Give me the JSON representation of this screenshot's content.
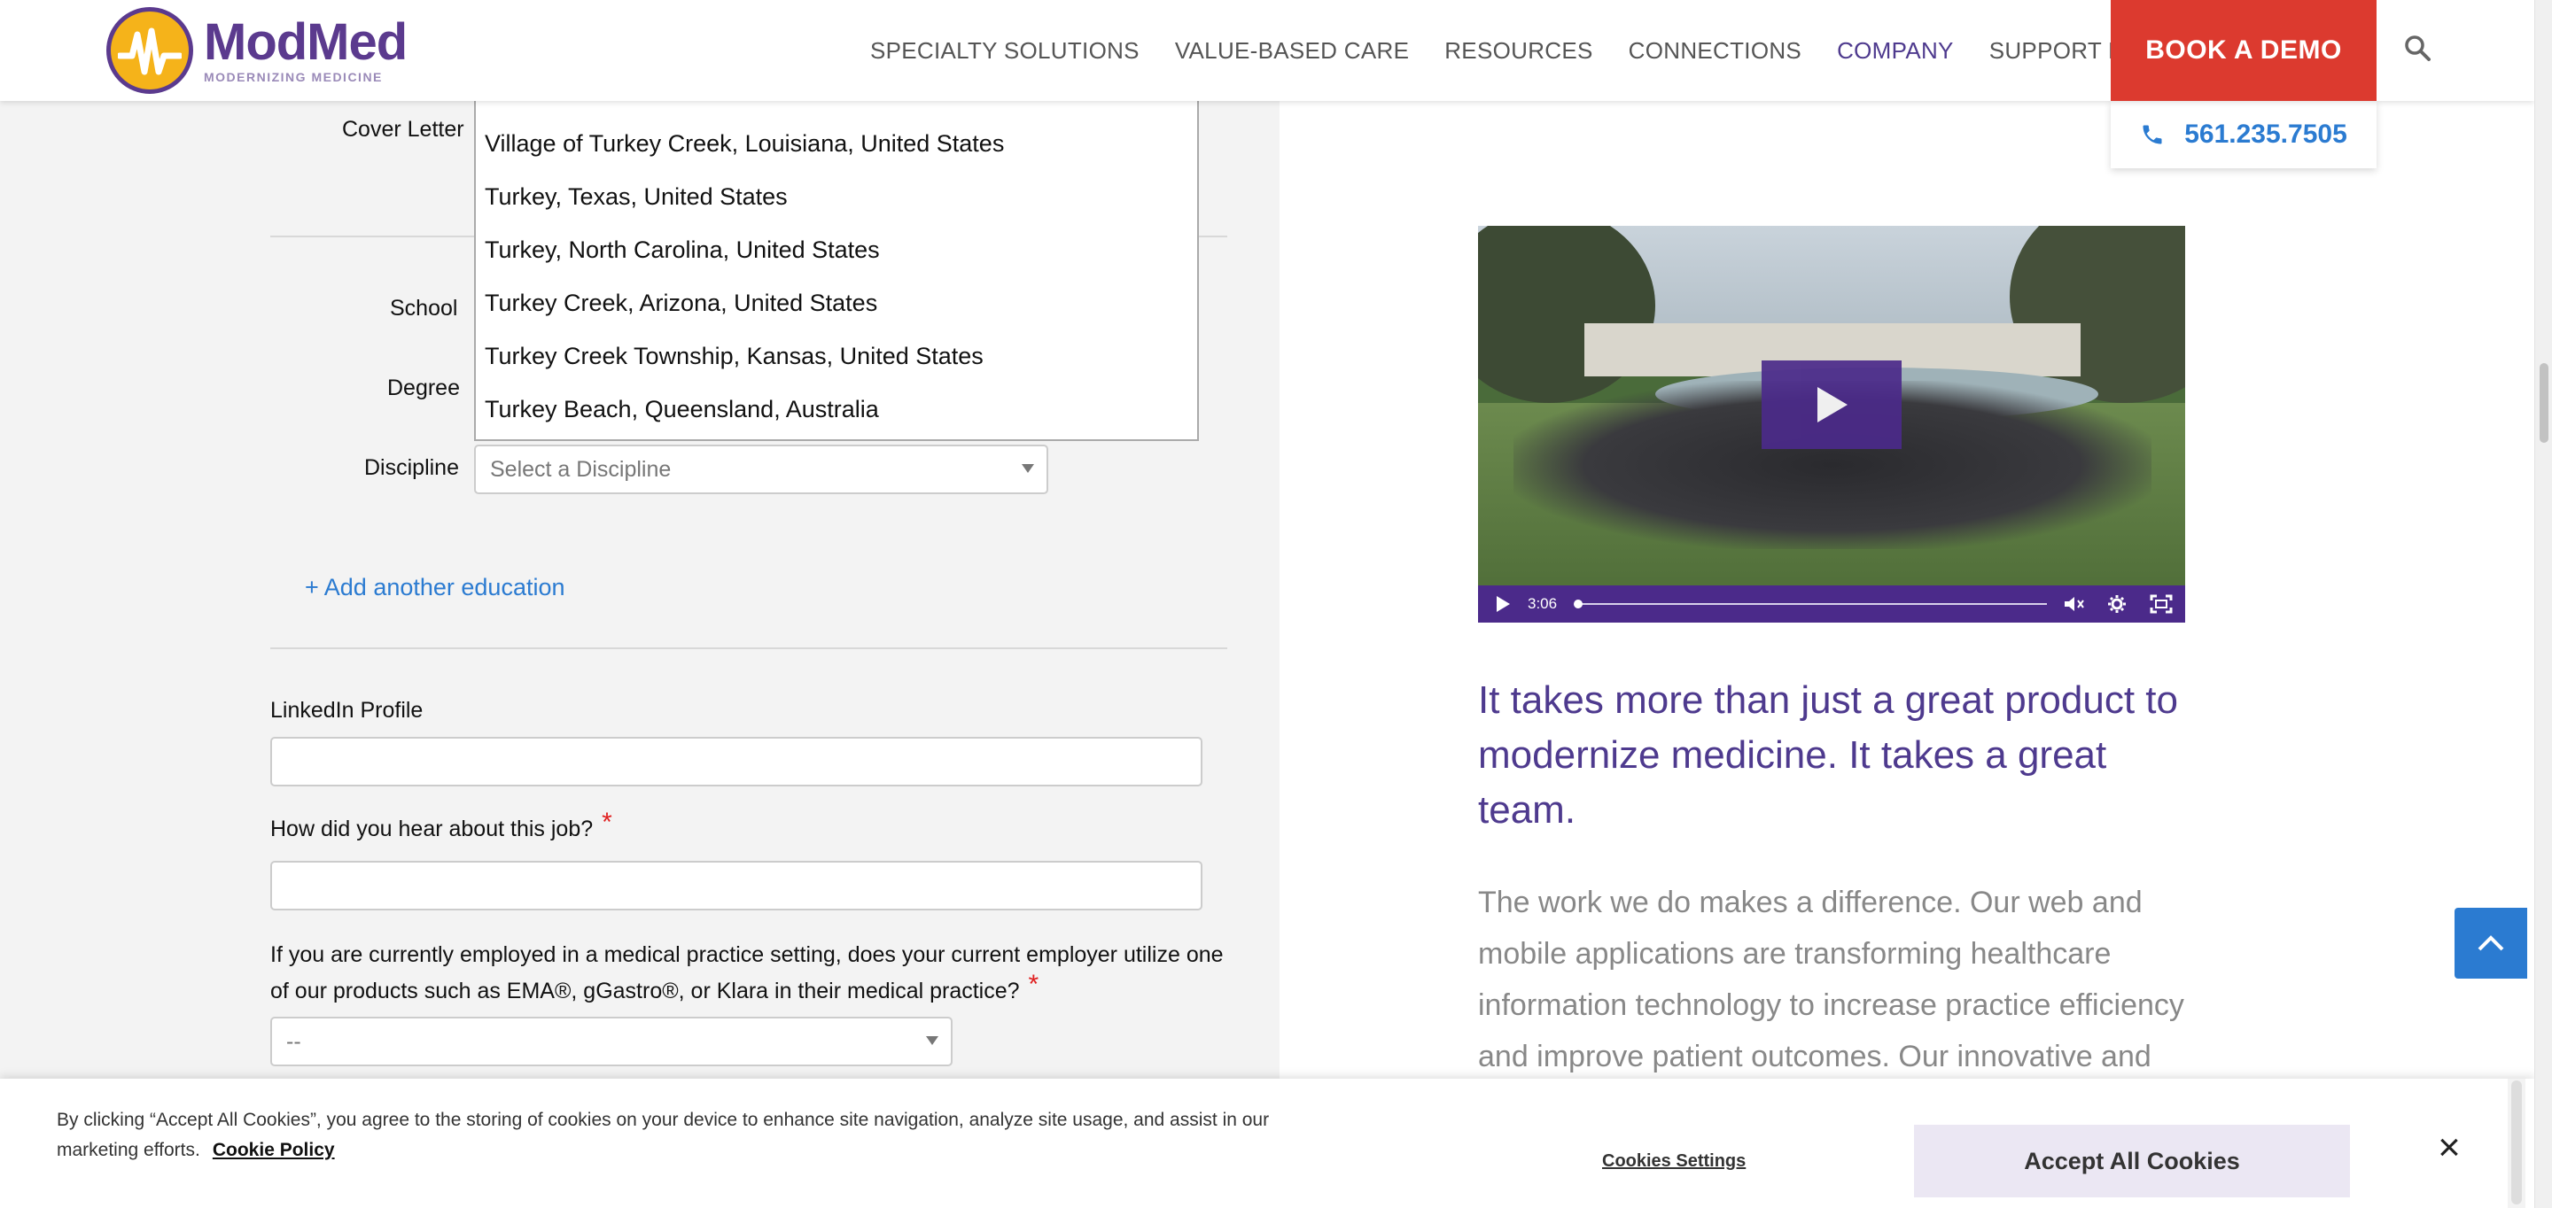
{
  "header": {
    "logo_name": "ModMed",
    "logo_tagline": "MODERNIZING MEDICINE",
    "nav": [
      {
        "label": "SPECIALTY SOLUTIONS"
      },
      {
        "label": "VALUE-BASED CARE"
      },
      {
        "label": "RESOURCES"
      },
      {
        "label": "CONNECTIONS"
      },
      {
        "label": "COMPANY",
        "active": true
      },
      {
        "label": "SUPPORT LOGIN"
      }
    ],
    "demo_button": "BOOK A DEMO",
    "phone": "561.235.7505",
    "colors": {
      "brand_purple": "#4e3a8e",
      "demo_red": "#dc3a2f",
      "link_blue": "#2b7bd1"
    }
  },
  "form": {
    "cover_letter_label": "Cover Letter",
    "school_label": "School",
    "degree_label": "Degree",
    "discipline_label": "Discipline",
    "discipline_placeholder": "Select a Discipline",
    "add_education": "+ Add another education",
    "linkedin_label": "LinkedIn Profile",
    "linkedin_value": "",
    "hear_label": "How did you hear about this job?",
    "hear_value": "",
    "employer_question": "If you are currently employed in a medical practice setting, does your current employer utilize one of our products such as EMA®, gGastro®, or Klara in their medical practice?",
    "employer_select_value": "--",
    "required_mark": "*"
  },
  "location_dropdown": {
    "items": [
      "Village of Turkey Creek, Louisiana, United States",
      "Turkey, Texas, United States",
      "Turkey, North Carolina, United States",
      "Turkey Creek, Arizona, United States",
      "Turkey Creek Township, Kansas, United States",
      "Turkey Beach, Queensland, Australia"
    ]
  },
  "video": {
    "duration": "3:06"
  },
  "content": {
    "tagline": "It takes more than just a great product to modernize medicine. It takes a great team.",
    "body": "The work we do makes a difference. Our web and mobile applications are transforming healthcare information technology to increase practice efficiency and improve patient outcomes. Our innovative and"
  },
  "cookie_banner": {
    "text": "By clicking “Accept All Cookies”, you agree to the storing of cookies on your device to enhance site navigation, analyze site usage, and assist in our marketing efforts.",
    "policy_link": "Cookie Policy",
    "settings_button": "Cookies Settings",
    "accept_button": "Accept All Cookies",
    "close": "×"
  }
}
